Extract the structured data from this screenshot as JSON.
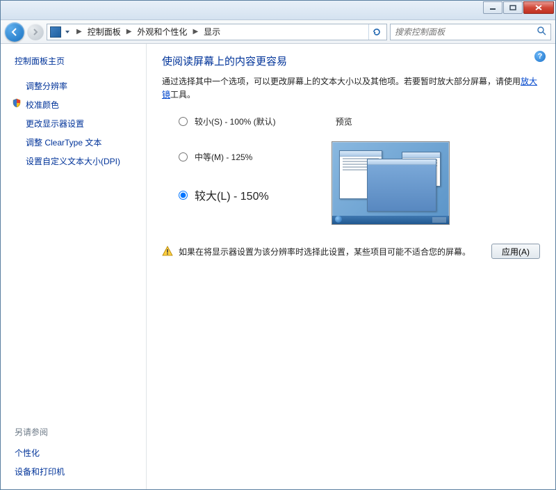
{
  "breadcrumb": {
    "items": [
      "控制面板",
      "外观和个性化",
      "显示"
    ]
  },
  "search": {
    "placeholder": "搜索控制面板"
  },
  "sidebar": {
    "title": "控制面板主页",
    "links": [
      {
        "label": "调整分辨率",
        "shield": false
      },
      {
        "label": "校准颜色",
        "shield": true
      },
      {
        "label": "更改显示器设置",
        "shield": false
      },
      {
        "label": "调整 ClearType 文本",
        "shield": false
      },
      {
        "label": "设置自定义文本大小(DPI)",
        "shield": false
      }
    ],
    "see_also_title": "另请参阅",
    "see_also": [
      "个性化",
      "设备和打印机"
    ]
  },
  "main": {
    "title": "使阅读屏幕上的内容更容易",
    "desc_prefix": "通过选择其中一个选项，可以更改屏幕上的文本大小以及其他项。若要暂时放大部分屏幕，请使用",
    "desc_link": "放大镜",
    "desc_suffix": "工具。",
    "options": [
      {
        "label": "较小(S) - 100% (默认)",
        "selected": false,
        "size": "normal"
      },
      {
        "label": "中等(M) - 125%",
        "selected": false,
        "size": "normal"
      },
      {
        "label": "较大(L) - 150%",
        "selected": true,
        "size": "large"
      }
    ],
    "preview_label": "预览",
    "warning": "如果在将显示器设置为该分辨率时选择此设置，某些项目可能不适合您的屏幕。",
    "apply_button": "应用(A)"
  }
}
